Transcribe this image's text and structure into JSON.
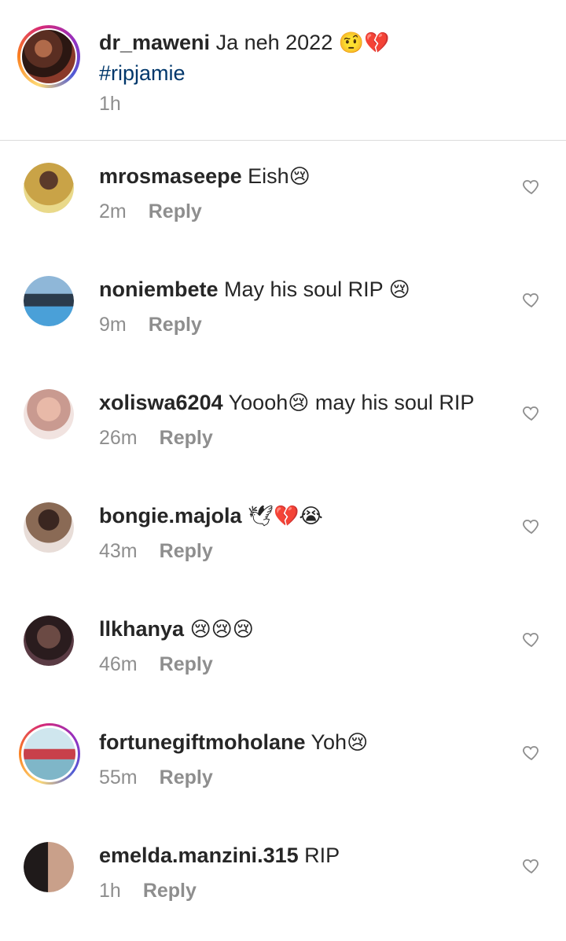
{
  "caption": {
    "username": "dr_maweni",
    "text": "Ja neh 2022",
    "emoji": "🤨💔",
    "hashtag": "#ripjamie",
    "time": "1h"
  },
  "comments": [
    {
      "username": "mrosmaseepe",
      "text": "Eish",
      "emoji": "😢",
      "time": "2m",
      "reply": "Reply",
      "avatar_color": "#c9a347",
      "story_ring": false
    },
    {
      "username": "noniembete",
      "text": "May his soul RIP",
      "emoji": "😢",
      "time": "9m",
      "reply": "Reply",
      "avatar_color": "#4a6f8f",
      "story_ring": false
    },
    {
      "username": "xoliswa6204",
      "text": "Yoooh",
      "emoji": "😢",
      "text2": "may his soul RIP",
      "time": "26m",
      "reply": "Reply",
      "avatar_color": "#d9a9a4",
      "story_ring": false
    },
    {
      "username": "bongie.majola",
      "text": "",
      "emoji": "🕊💔😭",
      "time": "43m",
      "reply": "Reply",
      "avatar_color": "#8a6a55",
      "story_ring": false
    },
    {
      "username": "llkhanya",
      "text": "",
      "emoji": "😢😢😢",
      "time": "46m",
      "reply": "Reply",
      "avatar_color": "#5a3b44",
      "story_ring": false
    },
    {
      "username": "fortunegiftmoholane",
      "text": "Yoh",
      "emoji": "😢",
      "time": "55m",
      "reply": "Reply",
      "avatar_color": "#7fb6c8",
      "story_ring": true
    },
    {
      "username": "emelda.manzini.315",
      "text": "RIP",
      "emoji": "",
      "time": "1h",
      "reply": "Reply",
      "avatar_color": "#3d3532",
      "story_ring": false
    }
  ]
}
